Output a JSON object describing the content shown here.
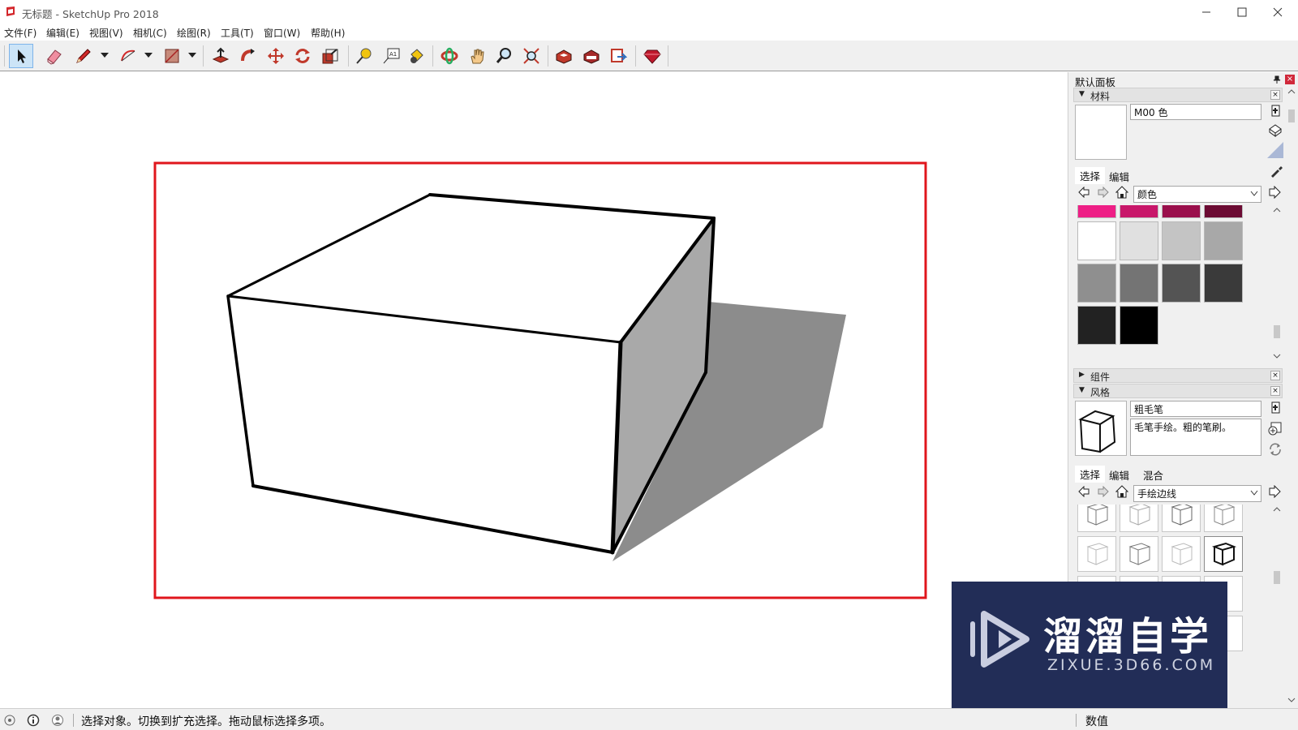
{
  "window": {
    "title": "无标题 - SketchUp Pro 2018"
  },
  "menu": [
    "文件(F)",
    "编辑(E)",
    "视图(V)",
    "相机(C)",
    "绘图(R)",
    "工具(T)",
    "窗口(W)",
    "帮助(H)"
  ],
  "toolbar": {
    "tools": [
      "select",
      "eraser",
      "line",
      "arc",
      "rectangle",
      "push-pull",
      "follow-me",
      "move",
      "rotate",
      "scale",
      "tape-measure",
      "text",
      "paint-bucket",
      "orbit",
      "pan",
      "zoom",
      "zoom-extents",
      "warehouse",
      "extension-warehouse",
      "layout",
      "ruby"
    ]
  },
  "panel": {
    "title": "默认面板",
    "materials": {
      "header": "材料",
      "name": "M00 色",
      "tabs": [
        "选择",
        "编辑"
      ],
      "library": "颜色",
      "colors": {
        "row1": [
          "#ee1f86",
          "#c8176a",
          "#9a0f4c",
          "#6c0b33"
        ],
        "row2": [
          "#ffffff",
          "#e0e0e0",
          "#c4c4c4",
          "#a8a8a8"
        ],
        "row3": [
          "#8f8f8f",
          "#747474",
          "#545454",
          "#3a3a3a"
        ],
        "row4": [
          "#222222",
          "#000000"
        ]
      }
    },
    "components": {
      "header": "组件"
    },
    "styles": {
      "header": "风格",
      "name": "粗毛笔",
      "description": "毛笔手绘。粗的笔刷。",
      "tabs": [
        "选择",
        "编辑",
        "混合"
      ],
      "library": "手绘边线"
    }
  },
  "status": {
    "message": "选择对象。切换到扩充选择。拖动鼠标选择多项。",
    "vcb_label": "数值"
  },
  "watermark": {
    "cn": "溜溜自学",
    "en": "ZIXUE.3D66.COM"
  },
  "colors": {
    "highlight_frame": "#e0161c",
    "watermark_bg": "#222d57",
    "shadow": "#8c8c8c",
    "side_face": "#a9a9a9"
  }
}
